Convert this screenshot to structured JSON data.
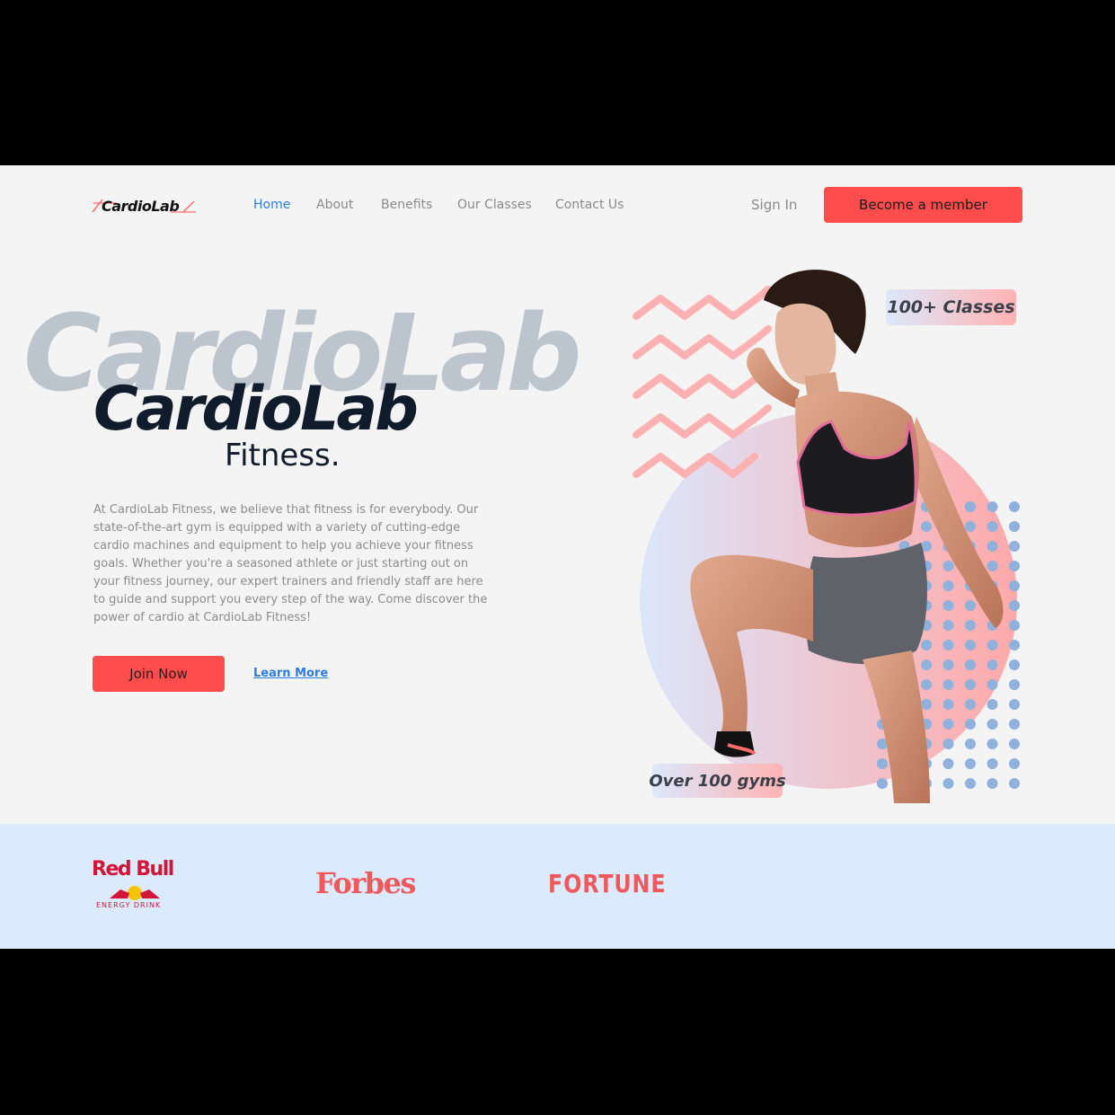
{
  "nav": {
    "logo": "CardioLab",
    "links": [
      "Home",
      "About",
      "Benefits",
      "Our Classes",
      "Contact Us"
    ],
    "active_link": "Home",
    "sign_in": "Sign In",
    "cta": "Become a member"
  },
  "hero": {
    "bg_title": "CardioLab",
    "title": "CardioLab",
    "subtitle": "Fitness.",
    "description": "At CardioLab Fitness, we believe that fitness is for everybody. Our state-of-the-art gym is equipped with a variety of cutting-edge cardio machines and equipment to help you achieve your fitness goals. Whether you're a seasoned athlete or just starting out on your fitness journey, our expert trainers and friendly staff are here to guide and support you every step of the way. Come discover the power of cardio at CardioLab Fitness!",
    "join_button": "Join Now",
    "learn_more": "Learn More",
    "badge_classes": "100+ Classes",
    "badge_gyms": "Over 100 gyms"
  },
  "brands": {
    "redbull_name": "Red Bull",
    "redbull_sub": "ENERGY DRINK",
    "forbes": "Forbes",
    "fortune": "FORTUNE"
  },
  "colors": {
    "accent": "#ff4d4d",
    "link": "#2b7de0",
    "dark": "#101c2c",
    "brand_band": "#dbeafc",
    "dots": "#8fb1dc",
    "zigzag": "#ffb0b0"
  },
  "icons": [
    "athlete-photo",
    "zigzag-decoration",
    "dot-grid-decoration",
    "redbull-bulls-logo"
  ]
}
